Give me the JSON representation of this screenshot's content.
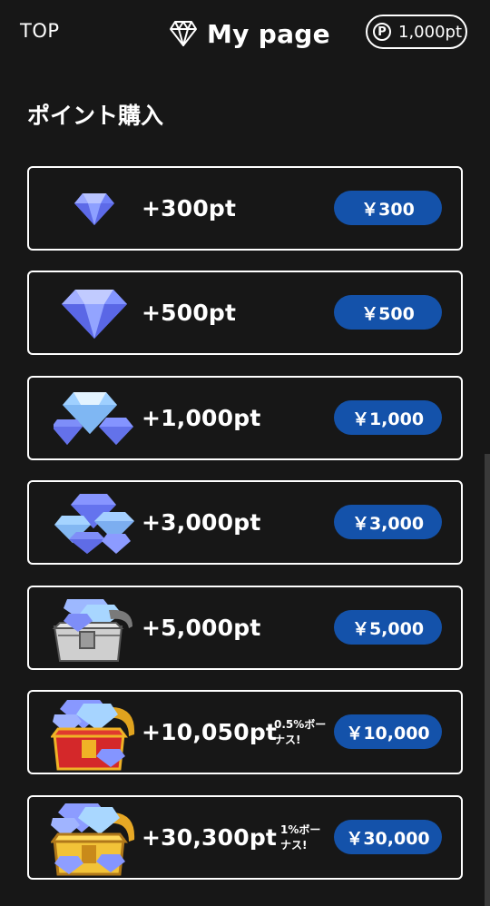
{
  "header": {
    "top_link": "TOP",
    "title": "My page",
    "points": "1,000pt",
    "points_icon_letter": "P"
  },
  "section": {
    "title": "ポイント購入"
  },
  "packages": [
    {
      "amount": "+300pt",
      "price": "￥300",
      "bonus": "",
      "icon": "diamond-small-icon"
    },
    {
      "amount": "+500pt",
      "price": "￥500",
      "bonus": "",
      "icon": "diamond-large-icon"
    },
    {
      "amount": "+1,000pt",
      "price": "￥1,000",
      "bonus": "",
      "icon": "diamond-cluster-icon"
    },
    {
      "amount": "+3,000pt",
      "price": "￥3,000",
      "bonus": "",
      "icon": "diamond-pile-icon"
    },
    {
      "amount": "+5,000pt",
      "price": "￥5,000",
      "bonus": "",
      "icon": "silver-chest-icon"
    },
    {
      "amount": "+10,050pt",
      "price": "￥10,000",
      "bonus": "0.5%ボーナス!",
      "icon": "red-chest-icon"
    },
    {
      "amount": "+30,300pt",
      "price": "￥30,000",
      "bonus": "1%ボーナス!",
      "icon": "gold-chest-icon"
    }
  ],
  "colors": {
    "background": "#171717",
    "button": "#1452aa",
    "diamond": "#7f93ff"
  }
}
